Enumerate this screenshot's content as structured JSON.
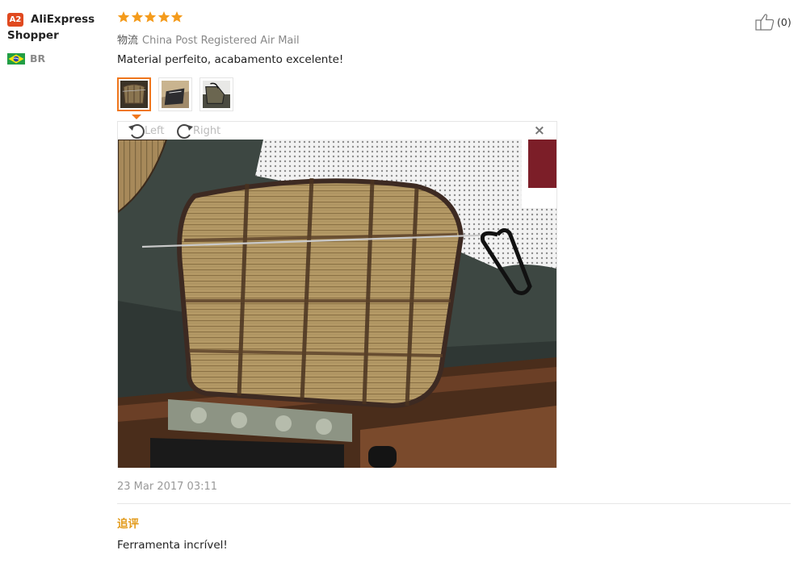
{
  "user": {
    "badge": "A2",
    "name": "AliExpress Shopper",
    "country": "BR",
    "flag_icon": "brazil-flag-icon"
  },
  "review": {
    "rating": 5,
    "rating_max": 5,
    "star_icon": "star-icon",
    "star_color": "#f49b1c",
    "shipping_label": "物流",
    "shipping_method": "China Post Registered Air Mail",
    "text": "Material perfeito, acabamento excelente!",
    "helpful_count": "(0)",
    "helpful_icon": "thumbs-up-icon",
    "date": "23 Mar 2017 03:11"
  },
  "thumbnails": [
    {
      "name": "photo-thumbnail-1",
      "active": true
    },
    {
      "name": "photo-thumbnail-2",
      "active": false
    },
    {
      "name": "photo-thumbnail-3",
      "active": false
    }
  ],
  "viewer": {
    "rotate_left_label": "Left",
    "rotate_right_label": "Right",
    "close_glyph": "×",
    "accent_color": "#f0771d"
  },
  "additional_feedback": {
    "label": "追评",
    "text": "Ferramenta incrível!",
    "label_color": "#e29a1a"
  }
}
